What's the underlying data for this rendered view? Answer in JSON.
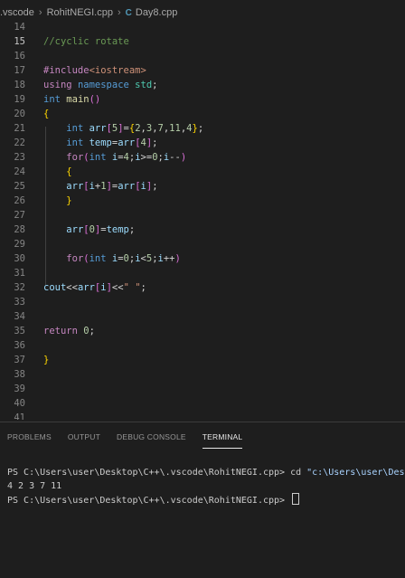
{
  "breadcrumb": {
    "folder": ".vscode",
    "file1": "RohitNEGI.cpp",
    "file2": "Day8.cpp",
    "file_icon": "C"
  },
  "editor": {
    "lines": [
      {
        "n": "14",
        "code": ""
      },
      {
        "n": "15",
        "code": "//cyclic rotate"
      },
      {
        "n": "16",
        "code": ""
      },
      {
        "n": "17",
        "code": "#include<iostream>"
      },
      {
        "n": "18",
        "code": "using namespace std;"
      },
      {
        "n": "19",
        "code": "int main()"
      },
      {
        "n": "20",
        "code": "{"
      },
      {
        "n": "21",
        "code": "    int arr[5]={2,3,7,11,4};"
      },
      {
        "n": "22",
        "code": "    int temp=arr[4];"
      },
      {
        "n": "23",
        "code": "    for(int i=4;i>=0;i--)"
      },
      {
        "n": "24",
        "code": "    {"
      },
      {
        "n": "25",
        "code": "    arr[i+1]=arr[i];"
      },
      {
        "n": "26",
        "code": "    }"
      },
      {
        "n": "27",
        "code": ""
      },
      {
        "n": "28",
        "code": "    arr[0]=temp;"
      },
      {
        "n": "29",
        "code": ""
      },
      {
        "n": "30",
        "code": "    for(int i=0;i<5;i++)"
      },
      {
        "n": "31",
        "code": ""
      },
      {
        "n": "32",
        "code": "cout<<arr[i]<<\" \";"
      },
      {
        "n": "33",
        "code": ""
      },
      {
        "n": "34",
        "code": ""
      },
      {
        "n": "35",
        "code": "return 0;"
      },
      {
        "n": "36",
        "code": ""
      },
      {
        "n": "37",
        "code": "}"
      },
      {
        "n": "38",
        "code": ""
      },
      {
        "n": "39",
        "code": ""
      },
      {
        "n": "40",
        "code": ""
      },
      {
        "n": "41",
        "code": ""
      }
    ],
    "current_line": "15"
  },
  "panel": {
    "tabs": [
      "PROBLEMS",
      "OUTPUT",
      "DEBUG CONSOLE",
      "TERMINAL"
    ],
    "active_tab": "TERMINAL"
  },
  "terminal": {
    "line1_prompt": "PS C:\\Users\\user\\Desktop\\C++\\.vscode\\RohitNEGI.cpp> cd ",
    "line1_quoted": "\"c:\\Users\\user\\Desktop",
    "line2": "4 2 3 7 11",
    "line3_prompt": "PS C:\\Users\\user\\Desktop\\C++\\.vscode\\RohitNEGI.cpp> "
  },
  "colors": {
    "background": "#1e1e1e",
    "keyword": "#c586c0",
    "type": "#569cd6",
    "comment": "#6a9955",
    "number": "#b5cea8"
  }
}
